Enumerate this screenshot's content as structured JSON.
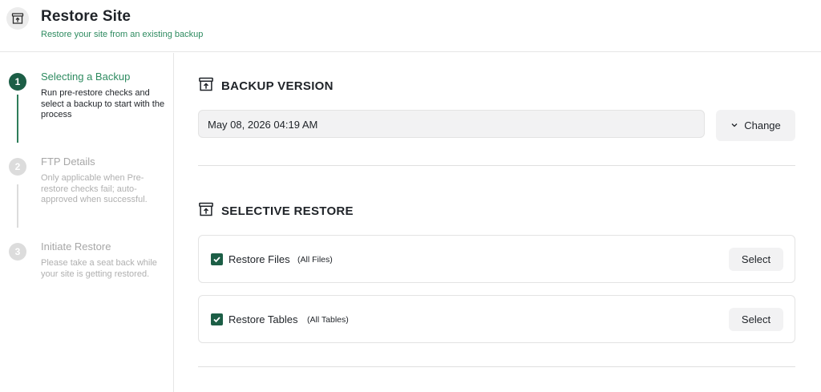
{
  "header": {
    "title": "Restore Site",
    "subtitle": "Restore your site from an existing backup",
    "icon": "archive-restore-icon"
  },
  "steps": [
    {
      "number": "1",
      "title": "Selecting a Backup",
      "description": "Run pre-restore checks and select a backup to start with the process",
      "state": "active"
    },
    {
      "number": "2",
      "title": "FTP Details",
      "description": "Only applicable when Pre-restore checks fail; auto-approved when successful.",
      "state": "inactive"
    },
    {
      "number": "3",
      "title": "Initiate Restore",
      "description": "Please take a seat back while your site is getting restored.",
      "state": "inactive"
    }
  ],
  "backup_version": {
    "heading": "BACKUP VERSION",
    "value": "May 08, 2026 04:19 AM",
    "change_label": "Change"
  },
  "selective_restore": {
    "heading": "SELECTIVE RESTORE",
    "items": [
      {
        "label": "Restore Files",
        "sub": "(All Files)",
        "checked": true,
        "button": "Select"
      },
      {
        "label": "Restore Tables",
        "sub": "(All Tables)",
        "checked": true,
        "button": "Select"
      }
    ]
  },
  "colors": {
    "accent": "#1c5e46",
    "accent_text": "#2e8b60",
    "inactive": "#dcdcdc"
  }
}
